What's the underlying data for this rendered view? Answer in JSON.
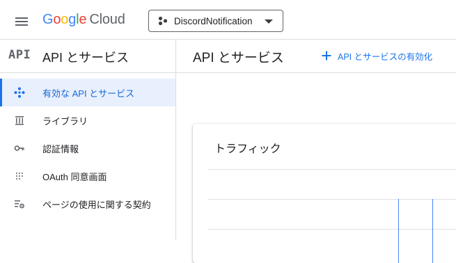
{
  "header": {
    "logo": {
      "google": "Google",
      "cloud": "Cloud"
    },
    "project": "DiscordNotification"
  },
  "sidebar": {
    "badge": "API",
    "title": "API とサービス",
    "items": [
      {
        "label": "有効な API とサービス",
        "icon": "api-diamond-icon",
        "active": true
      },
      {
        "label": "ライブラリ",
        "icon": "library-icon",
        "active": false
      },
      {
        "label": "認証情報",
        "icon": "key-icon",
        "active": false
      },
      {
        "label": "OAuth 同意画面",
        "icon": "consent-icon",
        "active": false
      },
      {
        "label": "ページの使用に関する契約",
        "icon": "agreement-settings-icon",
        "active": false
      }
    ]
  },
  "main": {
    "title": "API とサービス",
    "enable_button": "API とサービスの有効化",
    "traffic_card": {
      "title": "トラフィック"
    }
  },
  "colors": {
    "accent": "#1a73e8",
    "active_bg": "#e8f0fe",
    "divider": "#dadce0",
    "spike": "#4285f4"
  }
}
